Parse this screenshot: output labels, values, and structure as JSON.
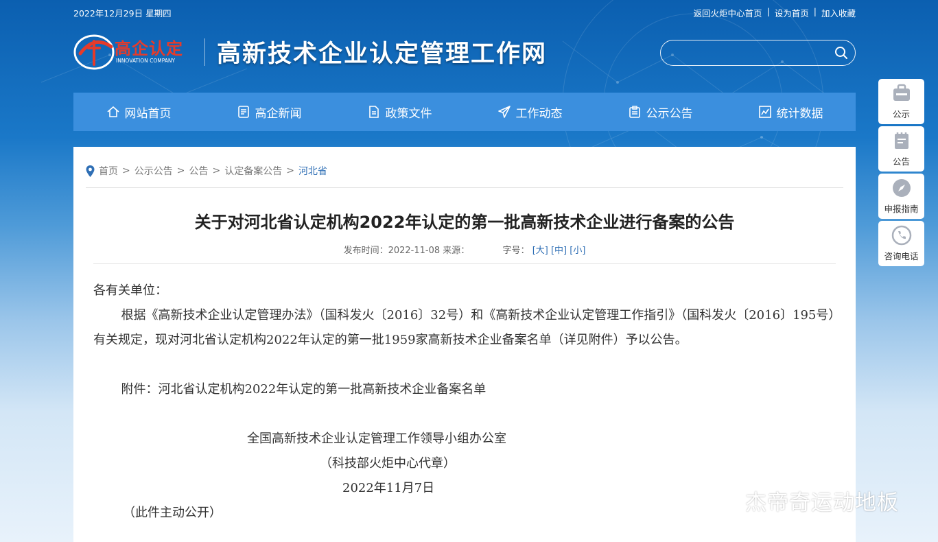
{
  "header": {
    "date": "2022年12月29日 星期四",
    "links": [
      "返回火炬中心首页",
      "设为首页",
      "加入收藏"
    ],
    "logo_text": "高企认定",
    "logo_sub": "INNOVATION COMPANY",
    "site_title": "高新技术企业认定管理工作网",
    "search_value": ""
  },
  "nav": {
    "items": [
      {
        "label": "网站首页",
        "icon": "home-icon"
      },
      {
        "label": "高企新闻",
        "icon": "news-icon"
      },
      {
        "label": "政策文件",
        "icon": "document-icon"
      },
      {
        "label": "工作动态",
        "icon": "paper-plane-icon"
      },
      {
        "label": "公示公告",
        "icon": "clipboard-icon"
      },
      {
        "label": "统计数据",
        "icon": "chart-icon"
      }
    ]
  },
  "breadcrumb": [
    "首页",
    "公示公告",
    "公告",
    "认定备案公告",
    "河北省"
  ],
  "article": {
    "title": "关于对河北省认定机构2022年认定的第一批高新技术企业进行备案的公告",
    "meta_prefix": "发布时间：2022-11-08 来源：",
    "font_label": "字号：",
    "font_large": "[大]",
    "font_medium": "[中]",
    "font_small": "[小]",
    "salutation": "各有关单位：",
    "paragraph": "根据《高新技术企业认定管理办法》（国科发火〔2016〕32号）和《高新技术企业认定管理工作指引》（国科发火〔2016〕195号）有关规定，现对河北省认定机构2022年认定的第一批1959家高新技术企业备案名单（详见附件）予以公告。",
    "attachment": "附件：河北省认定机构2022年认定的第一批高新技术企业备案名单",
    "sign_org": "全国高新技术企业认定管理工作领导小组办公室",
    "sign_seal": "（科技部火炬中心代章）",
    "sign_date": "2022年11月7日",
    "public_note": "（此件主动公开）"
  },
  "side_tools": [
    {
      "label": "公示",
      "icon": "briefcase-icon"
    },
    {
      "label": "公告",
      "icon": "notepad-icon"
    },
    {
      "label": "申报指南",
      "icon": "compass-icon"
    },
    {
      "label": "咨询电话",
      "icon": "phone-icon"
    }
  ],
  "watermark": {
    "text": "杰帝奇运动地板",
    "icon": "wechat-icon"
  },
  "colors": {
    "nav": "#3b8fde",
    "accent": "#2f6fb5",
    "logo_red": "#e53b2b"
  }
}
